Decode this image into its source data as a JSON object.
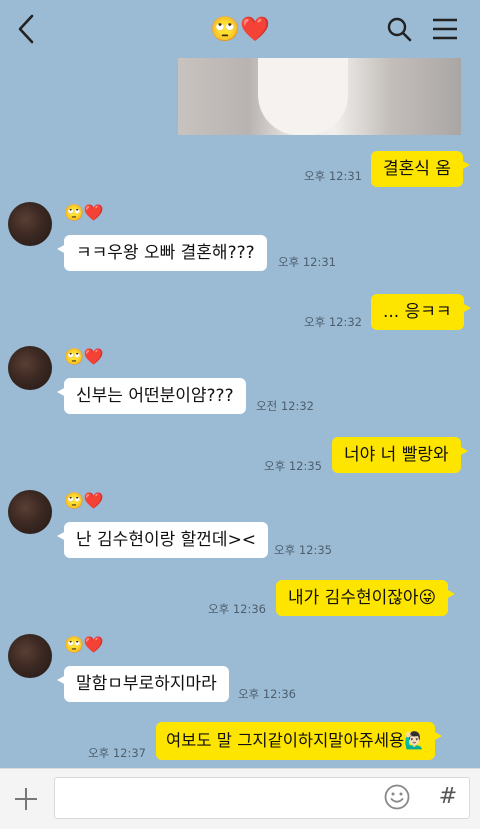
{
  "header": {
    "title_emoji": "🙄❤️",
    "icons": [
      "back-arrow-icon",
      "search-icon",
      "menu-icon"
    ]
  },
  "messages": [
    {
      "id": "m1",
      "from": "me",
      "text": "결혼식 옴",
      "time": "오후 12:31"
    },
    {
      "id": "m2",
      "from": "other",
      "sender": "🙄❤️",
      "text": "ㅋㅋ우왕 오빠 결혼해???",
      "time": "오후 12:31"
    },
    {
      "id": "m3",
      "from": "me",
      "text": "... 응ㅋㅋ",
      "time": "오후 12:32"
    },
    {
      "id": "m4",
      "from": "other",
      "sender": "🙄❤️",
      "text": "신부는 어떤분이얌???",
      "time": "오전 12:32"
    },
    {
      "id": "m5",
      "from": "me",
      "text": "너야 너 빨랑와",
      "time": "오후 12:35"
    },
    {
      "id": "m6",
      "from": "other",
      "sender": "🙄❤️",
      "text": "난 김수현이랑 할껀데><",
      "time": "오후 12:35"
    },
    {
      "id": "m7",
      "from": "me",
      "text": "내가 김수현이잖아😜",
      "time": "오후 12:36"
    },
    {
      "id": "m8",
      "from": "other",
      "sender": "🙄❤️",
      "text": "말함ㅁ부로하지마라",
      "time": "오후 12:36"
    },
    {
      "id": "m9",
      "from": "me",
      "text": "여보도 말 그지같이하지말아쥬세용🙋🏻‍♂️",
      "time": "오후 12:37"
    }
  ],
  "input": {
    "placeholder": "",
    "icons": [
      "plus-icon",
      "emoji-icon",
      "hashtag-icon"
    ],
    "hash_symbol": "#"
  },
  "colors": {
    "background": "#9bbbd4",
    "my_bubble": "#fee500",
    "other_bubble": "#ffffff"
  }
}
